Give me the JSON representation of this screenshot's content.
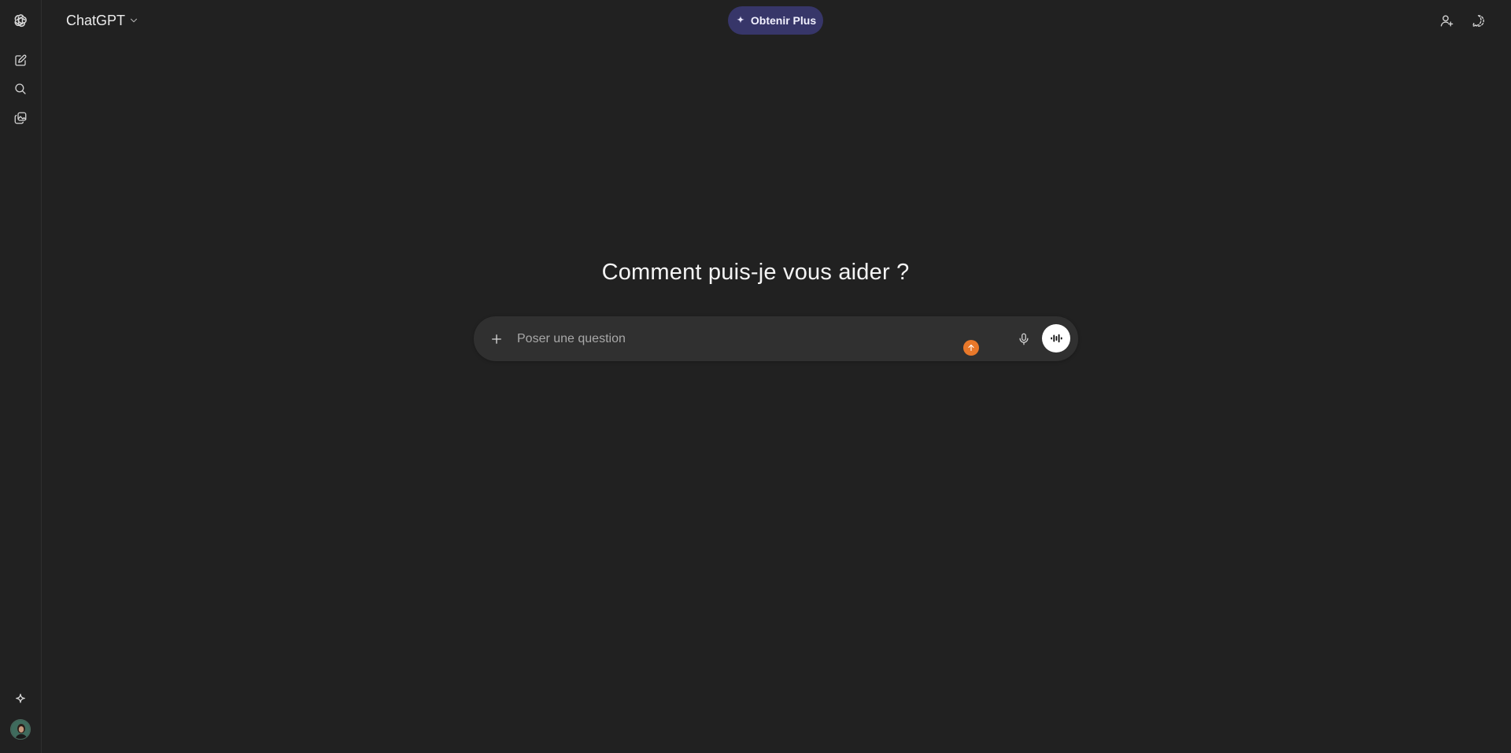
{
  "app": {
    "model_selector_label": "ChatGPT",
    "upgrade_label": "Obtenir Plus"
  },
  "sidebar": {
    "items": [
      {
        "icon": "openai-logo-icon"
      },
      {
        "icon": "new-chat-icon"
      },
      {
        "icon": "search-icon"
      },
      {
        "icon": "image-library-icon"
      },
      {
        "icon": "sparkle-icon"
      },
      {
        "icon": "avatar"
      }
    ]
  },
  "header": {
    "right_icons": [
      "add-user-icon",
      "temporary-chat-icon"
    ]
  },
  "main": {
    "greeting": "Comment puis-je vous aider ?"
  },
  "composer": {
    "placeholder": "Poser une question",
    "value": "",
    "icons": [
      "plus-icon",
      "upload-indicator-icon",
      "microphone-icon",
      "voice-mode-icon"
    ]
  },
  "colors": {
    "background": "#212121",
    "composer": "#303030",
    "upgrade_bg": "#373669",
    "indicator": "#e8782a"
  }
}
